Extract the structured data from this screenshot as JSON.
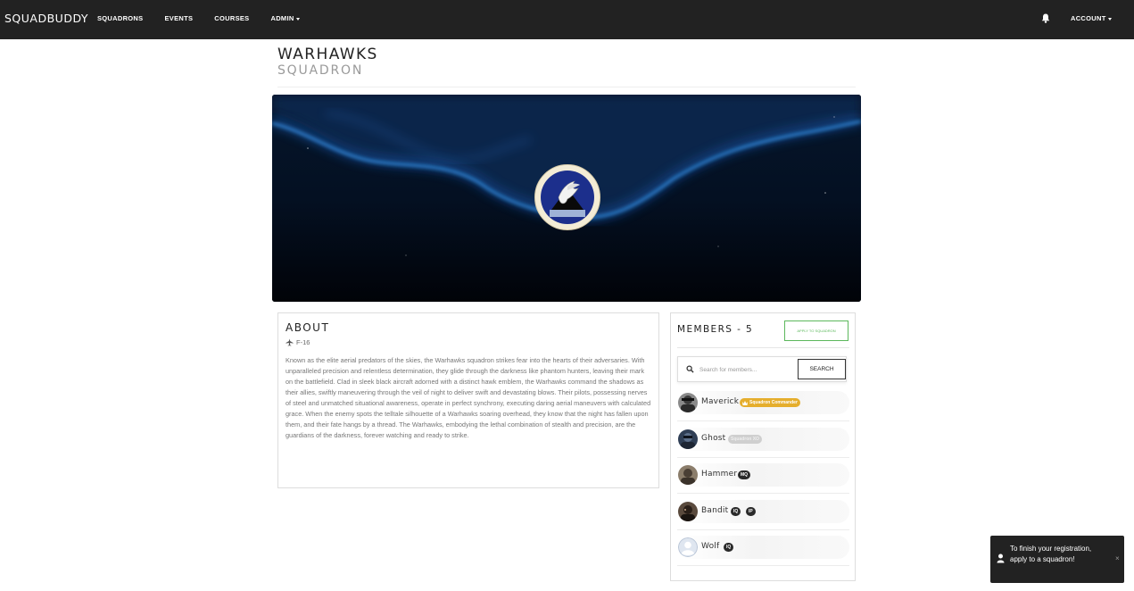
{
  "navbar": {
    "brand": "SQUADBUDDY",
    "links": [
      "SQUADRONS",
      "EVENTS",
      "COURSES",
      "ADMIN"
    ],
    "account": "ACCOUNT"
  },
  "squadron": {
    "name": "WARHAWKS",
    "subtitle": "SQUADRON"
  },
  "about": {
    "title": "ABOUT",
    "aircraft": "F-16",
    "description": "Known as the elite aerial predators of the skies, the Warhawks squadron strikes fear into the hearts of their adversaries. With unparalleled precision and relentless determination, they glide through the darkness like phantom hunters, leaving their mark on the battlefield. Clad in sleek black aircraft adorned with a distinct hawk emblem, the Warhawks command the shadows as their allies, swiftly maneuvering through the veil of night to deliver swift and devastating blows. Their pilots, possessing nerves of steel and unmatched situational awareness, operate in perfect synchrony, executing daring aerial maneuvers with calculated grace. When the enemy spots the telltale silhouette of a Warhawks soaring overhead, they know that the night has fallen upon them, and their fate hangs by a thread. The Warhawks, embodying the lethal combination of stealth and precision, are the guardians of the darkness, forever watching and ready to strike."
  },
  "members": {
    "title": "MEMBERS - 5",
    "apply_label": "APPLY TO SQUADRON",
    "search_placeholder": "Search for members...",
    "search_label": "SEARCH",
    "list": [
      {
        "name": "Maverick",
        "badges": [
          "Squadron Commander"
        ]
      },
      {
        "name": "Ghost",
        "badges": [
          "Squadron XO"
        ]
      },
      {
        "name": "Hammer",
        "badges": [
          "MQ"
        ]
      },
      {
        "name": "Bandit",
        "badges": [
          "IQ",
          "IP"
        ]
      },
      {
        "name": "Wolf",
        "badges": [
          "IQ"
        ]
      }
    ]
  },
  "toast": {
    "message": "To finish your registration, apply to a squadron!",
    "close": "×"
  },
  "colors": {
    "navbar": "#222222",
    "apply_green": "#5cb85c",
    "commander_gold": "#e5ae2d",
    "badge_dark": "#2a2a2a"
  }
}
